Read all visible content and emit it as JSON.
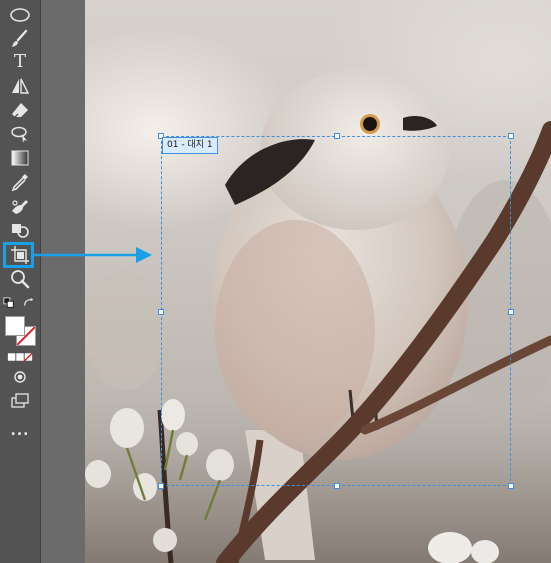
{
  "toolbar": {
    "tools": [
      {
        "name": "ellipse-marquee-icon"
      },
      {
        "name": "brush-icon"
      },
      {
        "name": "type-icon",
        "glyph": "T"
      },
      {
        "name": "flip-icon"
      },
      {
        "name": "eraser-icon"
      },
      {
        "name": "lasso-icon"
      },
      {
        "name": "gradient-icon"
      },
      {
        "name": "eyedropper-icon"
      },
      {
        "name": "spot-healing-icon"
      },
      {
        "name": "clone-stamp-icon"
      },
      {
        "name": "artboard-icon"
      },
      {
        "name": "zoom-icon"
      },
      {
        "name": "default-colors-icon"
      },
      {
        "name": "swap-colors-icon"
      },
      {
        "name": "foreground-color-swatch"
      },
      {
        "name": "background-color-swatch"
      },
      {
        "name": "quick-mask-icon"
      },
      {
        "name": "screen-mode-icon"
      },
      {
        "name": "more-tools-icon",
        "glyph": "..."
      }
    ],
    "highlight_color": "#19a0e8"
  },
  "artboard": {
    "label": "01 - 대지 1"
  },
  "colors": {
    "selection": "#3f8fe0",
    "callout": "#19a0e8",
    "toolbar_bg": "#535353"
  }
}
